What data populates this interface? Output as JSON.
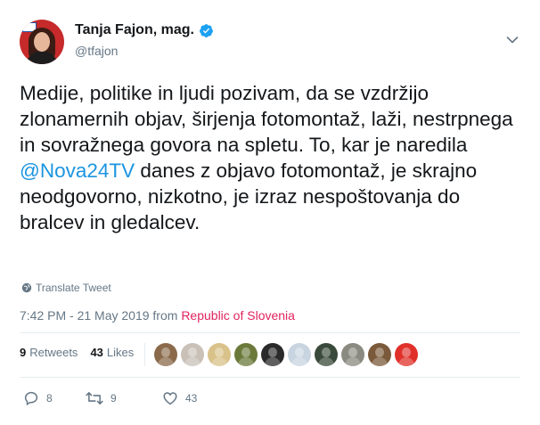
{
  "author": {
    "name": "Tanja Fajon, mag.",
    "handle": "@tfajon"
  },
  "tweet": {
    "text_part1": "Medije, politike in ljudi pozivam, da se vzdržijo zlonamernih objav, širjenja fotomontaž, laži, nestrpnega in sovražnega govora na spletu. To, kar je naredila ",
    "mention": "@Nova24TV",
    "text_part2": " danes z objavo fotomontaž, je skrajno neodgovorno, nizkotno, je izraz nespoštovanja do bralcev in gledalcev."
  },
  "translate_label": "Translate Tweet",
  "meta": {
    "timestamp": "7:42 PM - 21 May 2019",
    "from_label": "from",
    "location": "Republic of Slovenia"
  },
  "stats": {
    "retweets_count": "9",
    "retweets_label": "Retweets",
    "likes_count": "43",
    "likes_label": "Likes"
  },
  "likers": [
    {
      "color": "#8a6a4a",
      "icon": "avatar"
    },
    {
      "color": "#c9c0b8",
      "icon": "avatar"
    },
    {
      "color": "#d9c28a",
      "icon": "avatar"
    },
    {
      "color": "#6b7a3a",
      "icon": "avatar"
    },
    {
      "color": "#2a2a2a",
      "icon": "avatar"
    },
    {
      "color": "#c8d4e0",
      "icon": "avatar"
    },
    {
      "color": "#3a4a3a",
      "icon": "avatar"
    },
    {
      "color": "#8a8a80",
      "icon": "avatar"
    },
    {
      "color": "#7a5a3a",
      "icon": "avatar"
    },
    {
      "color": "#e0302a",
      "icon": "avatar"
    }
  ],
  "actions": {
    "reply_count": "8",
    "retweet_count": "9",
    "like_count": "43"
  },
  "colors": {
    "link": "#1b95e0",
    "location": "#e0245e",
    "secondary_text": "#657786",
    "divider": "#e6ecf0"
  }
}
